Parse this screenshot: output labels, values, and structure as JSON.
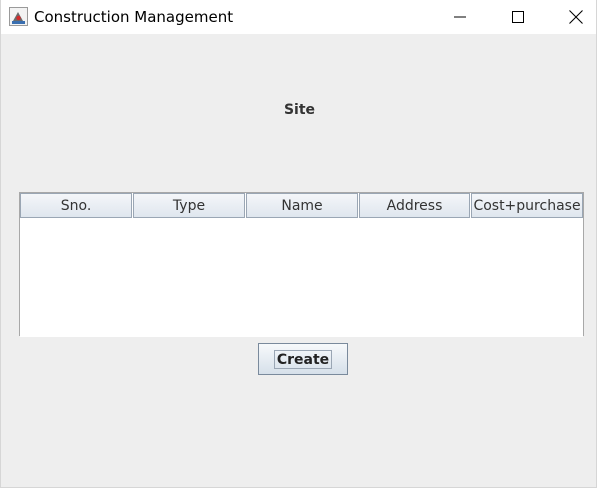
{
  "window": {
    "title": "Construction Management",
    "app_icon": "java-cup-icon",
    "controls": [
      "minimize-icon",
      "maximize-icon",
      "close-icon"
    ]
  },
  "page": {
    "heading": "Site"
  },
  "table": {
    "columns": [
      "Sno.",
      "Type",
      "Name",
      "Address",
      "Cost+purchase"
    ],
    "rows": []
  },
  "actions": {
    "create_label": "Create"
  }
}
